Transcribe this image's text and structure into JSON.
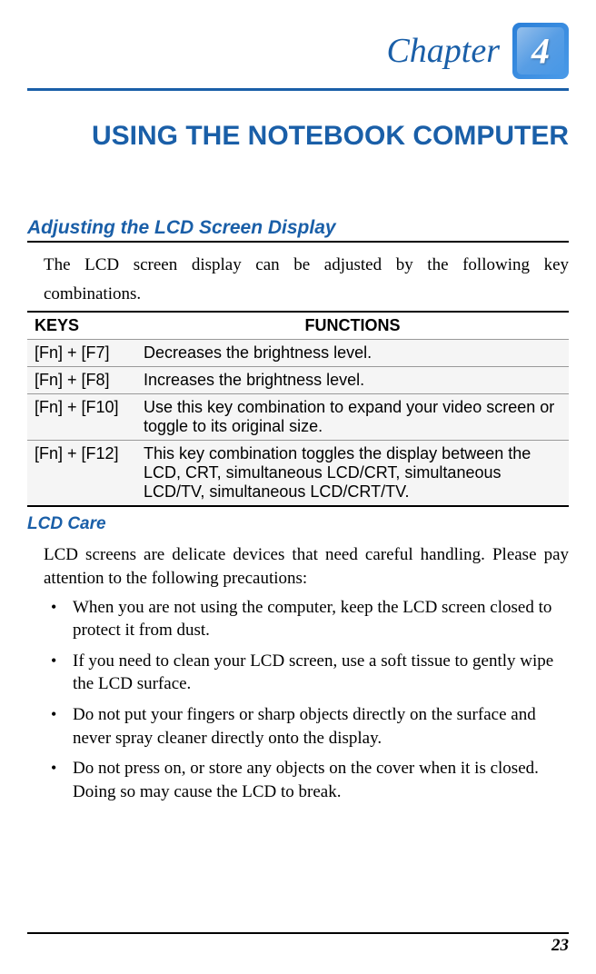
{
  "chapter": {
    "label": "Chapter",
    "number": "4"
  },
  "title": "USING THE NOTEBOOK COMPUTER",
  "section1": {
    "heading": "Adjusting the LCD Screen Display",
    "intro_line": "The LCD screen display can be adjusted by the following key",
    "intro_line2": "combinations.",
    "table": {
      "headers": {
        "keys": "KEYS",
        "functions": "FUNCTIONS"
      },
      "rows": [
        {
          "keys": "[Fn] + [F7]",
          "function": "Decreases the brightness level."
        },
        {
          "keys": "[Fn] + [F8]",
          "function": "Increases the brightness level."
        },
        {
          "keys": "[Fn] + [F10]",
          "function": "Use this key combination to expand your video screen or toggle to its original size."
        },
        {
          "keys": "[Fn] + [F12]",
          "function": "This key combination toggles the display between the LCD, CRT, simultaneous LCD/CRT, simultaneous LCD/TV, simultaneous LCD/CRT/TV."
        }
      ]
    }
  },
  "section2": {
    "heading": "LCD Care",
    "intro": "LCD screens are delicate devices that need careful handling.  Please pay attention to the following precautions:",
    "bullets": [
      "When you are not using the computer, keep the LCD screen closed to protect it from dust.",
      "If you need to clean your LCD screen, use a soft tissue to gently wipe the LCD surface.",
      "Do not put your fingers or sharp objects directly on the surface and never spray cleaner directly onto the display.",
      "Do not press on, or store any objects on the cover when it is closed.  Doing so may cause the LCD to break."
    ]
  },
  "page_number": "23"
}
